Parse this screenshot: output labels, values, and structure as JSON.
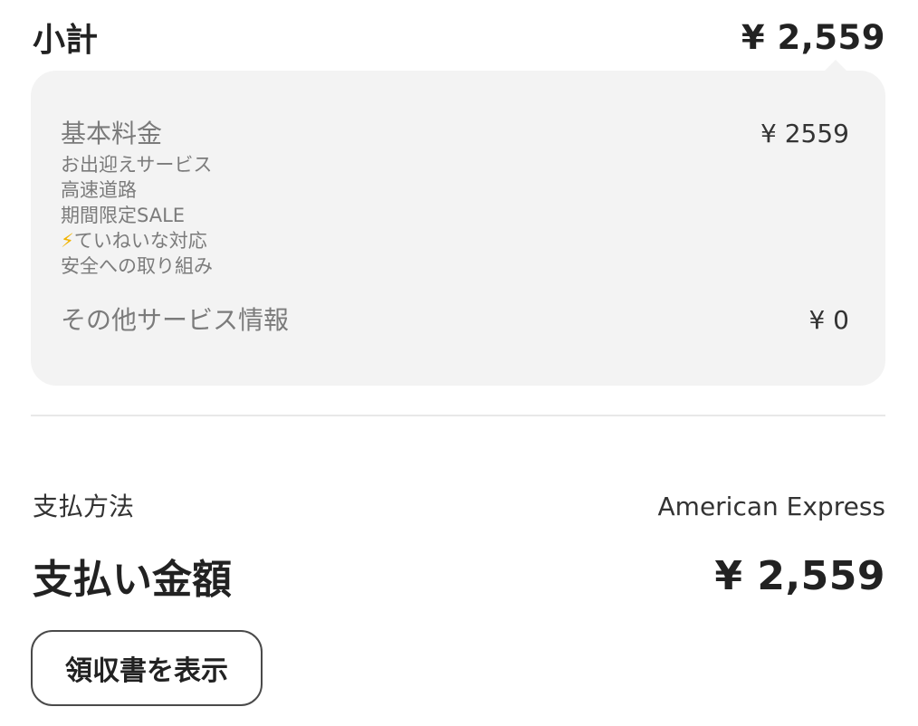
{
  "subtotal": {
    "label": "小計",
    "value": "¥ 2,559"
  },
  "breakdown": {
    "base_fee": {
      "title": "基本料金",
      "amount": "¥ 2559",
      "items": [
        {
          "text": "お出迎えサービス"
        },
        {
          "text": "高速道路"
        },
        {
          "text": "期間限定SALE"
        },
        {
          "icon": "⚡",
          "icon_name": "lightning-icon",
          "text": "ていねいな対応"
        },
        {
          "text": "安全への取り組み"
        }
      ]
    },
    "other_services": {
      "title": "その他サービス情報",
      "amount": "¥ 0"
    }
  },
  "payment": {
    "method_label": "支払方法",
    "method_value": "American Express",
    "total_label": "支払い金額",
    "total_value": "¥ 2,559"
  },
  "actions": {
    "receipt_button_label": "領収書を表示"
  },
  "colors": {
    "card_background": "#f3f3f3",
    "muted_text": "#7b7b7b",
    "primary_text": "#222222",
    "lightning_accent": "#f2b300"
  }
}
